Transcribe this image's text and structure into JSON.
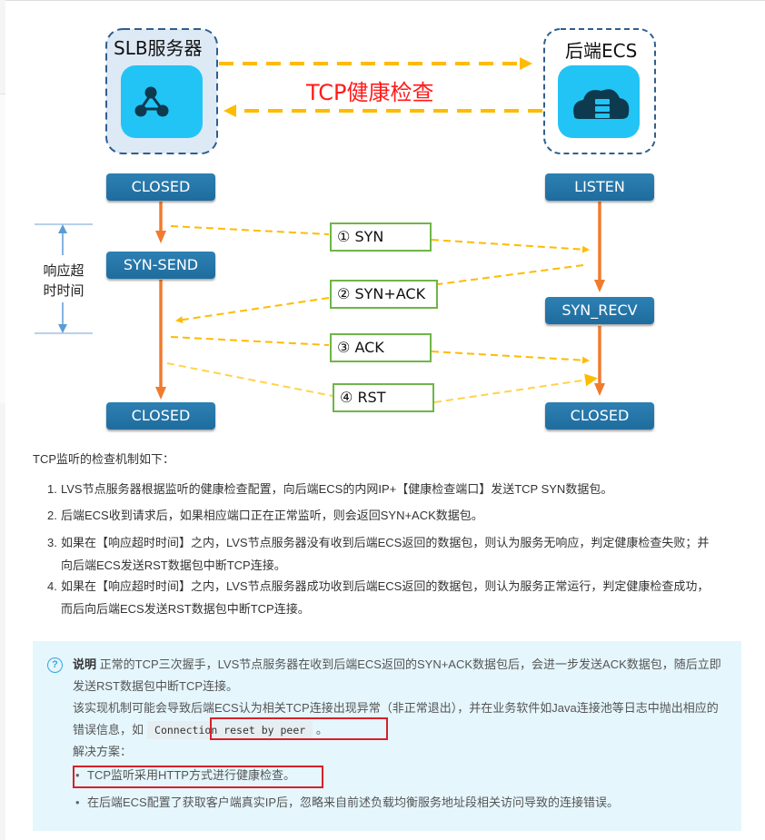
{
  "diagram": {
    "left_node_title": "SLB服务器",
    "right_node_title": "后端ECS",
    "center_title": "TCP健康检查",
    "left_states": [
      "CLOSED",
      "SYN-SEND",
      "CLOSED"
    ],
    "right_states": [
      "LISTEN",
      "SYN_RECV",
      "CLOSED"
    ],
    "messages": [
      {
        "marker": "①",
        "label": "SYN"
      },
      {
        "marker": "②",
        "label": "SYN+ACK"
      },
      {
        "marker": "③",
        "label": "ACK"
      },
      {
        "marker": "④",
        "label": "RST"
      }
    ],
    "timeout_label_line1": "响应超",
    "timeout_label_line2": "时时间",
    "colors": {
      "state_box": "#2677aa",
      "arrow_vertical": "#f07b2e",
      "arrow_dashed": "#ffbb00",
      "message_border": "#6fb548",
      "center_title": "#ff1a1a",
      "node_icon": "#22c4f5",
      "timeout_bracket": "#5b9bd5"
    }
  },
  "content": {
    "intro": "TCP监听的检查机制如下：",
    "steps": [
      {
        "num": "1.",
        "text": "LVS节点服务器根据监听的健康检查配置，向后端ECS的内网IP+【健康检查端口】发送TCP SYN数据包。"
      },
      {
        "num": "2.",
        "text": "后端ECS收到请求后，如果相应端口正在正常监听，则会返回SYN+ACK数据包。"
      },
      {
        "num": "3.",
        "text": "如果在【响应超时时间】之内，LVS节点服务器没有收到后端ECS返回的数据包，则认为服务无响应，判定健康检查失败；并向后端ECS发送RST数据包中断TCP连接。"
      },
      {
        "num": "4.",
        "text": "如果在【响应超时时间】之内，LVS节点服务器成功收到后端ECS返回的数据包，则认为服务正常运行，判定健康检查成功，而后向后端ECS发送RST数据包中断TCP连接。"
      }
    ]
  },
  "note": {
    "icon": "question-circle-icon",
    "label": "说明",
    "line1": "正常的TCP三次握手，LVS节点服务器在收到后端ECS返回的SYN+ACK数据包后，会进一步发送ACK数据包，随后立即发送RST数据包中断TCP连接。",
    "line2_prefix": "该实现机制可能会导致后端ECS认为相关TCP连接出现异常（非正常退出），并在业务软件如Java连接池等日志中抛出相应的错误信息，如",
    "code": "Connection reset by peer",
    "line2_suffix": "。",
    "solution_heading": "解决方案：",
    "solutions": [
      "TCP监听采用HTTP方式进行健康检查。",
      "在后端ECS配置了获取客户端真实IP后，忽略来自前述负载均衡服务地址段相关访问导致的连接错误。"
    ],
    "colors": {
      "background": "#e5f6fd",
      "highlight": "#d8202a",
      "icon": "#33a6e0"
    }
  }
}
